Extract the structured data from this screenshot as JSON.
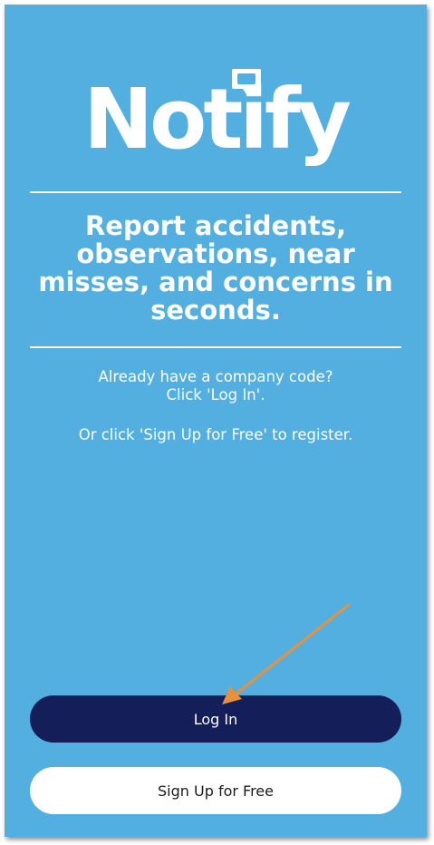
{
  "app": {
    "logo_text": "Notify"
  },
  "welcome": {
    "headline": "Report accidents, observations, near misses, and concerns in seconds.",
    "info_line1": "Already have a company code?",
    "info_line2": "Click 'Log In'.",
    "info_line3": "Or click 'Sign Up for Free' to register."
  },
  "buttons": {
    "login_label": "Log In",
    "signup_label": "Sign Up for Free"
  },
  "colors": {
    "background": "#53afdf",
    "login_button": "#141f5a",
    "signup_button": "#ffffff",
    "annotation_arrow": "#e8913a"
  },
  "icons": {
    "logo_bubble": "speech-bubble-icon",
    "annotation": "pointer-arrow-icon"
  }
}
